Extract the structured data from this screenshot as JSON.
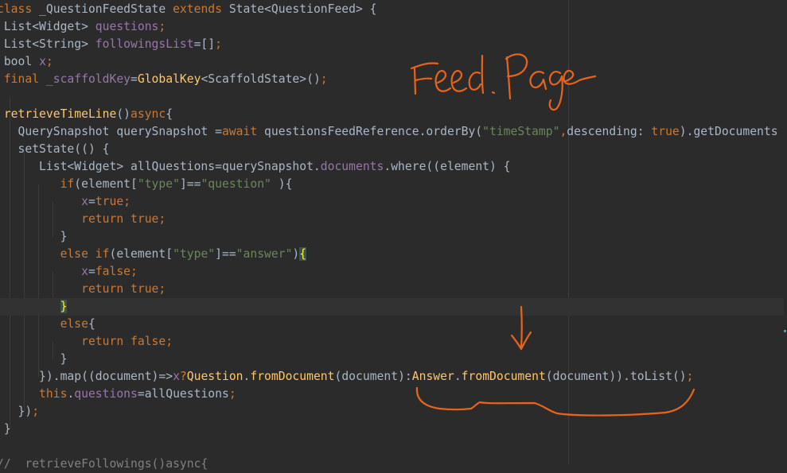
{
  "editor": {
    "lines": [
      [
        [
          "kw",
          "class"
        ],
        [
          "plain",
          " _QuestionFeedState "
        ],
        [
          "kw",
          "extends"
        ],
        [
          "plain",
          " State<QuestionFeed> {"
        ]
      ],
      [
        [
          "plain",
          " List<Widget> "
        ],
        [
          "field",
          "questions"
        ],
        [
          "kw",
          ";"
        ]
      ],
      [
        [
          "plain",
          " List<String> "
        ],
        [
          "field",
          "followingsList"
        ],
        [
          "plain",
          "=[]"
        ],
        [
          "kw",
          ";"
        ]
      ],
      [
        [
          "plain",
          " bool "
        ],
        [
          "field",
          "x"
        ],
        [
          "kw",
          ";"
        ]
      ],
      [
        [
          "kw",
          " final "
        ],
        [
          "field",
          "_scaffoldKey"
        ],
        [
          "plain",
          "="
        ],
        [
          "fn",
          "GlobalKey"
        ],
        [
          "plain",
          "<ScaffoldState>()"
        ],
        [
          "kw",
          ";"
        ]
      ],
      [],
      [
        [
          "fn",
          " retrieveTimeLine"
        ],
        [
          "plain",
          "()"
        ],
        [
          "kw",
          "async"
        ],
        [
          "plain",
          "{"
        ]
      ],
      [
        [
          "plain",
          "   QuerySnapshot querySnapshot ="
        ],
        [
          "kw",
          "await"
        ],
        [
          "plain",
          " questionsFeedReference.orderBy("
        ],
        [
          "str",
          "\"timeStamp\""
        ],
        [
          "kw",
          ","
        ],
        [
          "plain",
          "descending: "
        ],
        [
          "kw",
          "true"
        ],
        [
          "plain",
          ").getDocuments"
        ]
      ],
      [
        [
          "plain",
          "   setState(() {"
        ]
      ],
      [
        [
          "plain",
          "      List<Widget> allQuestions=querySnapshot."
        ],
        [
          "field",
          "documents"
        ],
        [
          "plain",
          ".where((element) {"
        ]
      ],
      [
        [
          "kw",
          "         if"
        ],
        [
          "plain",
          "(element["
        ],
        [
          "str",
          "\"type\""
        ],
        [
          "plain",
          "]=="
        ],
        [
          "str",
          "\"question\""
        ],
        [
          "plain",
          " ){"
        ]
      ],
      [
        [
          "field",
          "            x"
        ],
        [
          "plain",
          "="
        ],
        [
          "kw",
          "true;"
        ]
      ],
      [
        [
          "kw",
          "            return true;"
        ]
      ],
      [
        [
          "plain",
          "         }"
        ]
      ],
      [
        [
          "kw",
          "         else if"
        ],
        [
          "plain",
          "(element["
        ],
        [
          "str",
          "\"type\""
        ],
        [
          "plain",
          "]=="
        ],
        [
          "str",
          "\"answer\""
        ],
        [
          "plain",
          ")"
        ],
        [
          "brace",
          "{"
        ]
      ],
      [
        [
          "field",
          "            x"
        ],
        [
          "plain",
          "="
        ],
        [
          "kw",
          "false;"
        ]
      ],
      [
        [
          "kw",
          "            return true;"
        ]
      ],
      [
        [
          "plain",
          "         "
        ],
        [
          "brace",
          "}"
        ]
      ],
      [
        [
          "kw",
          "         else"
        ],
        [
          "plain",
          "{"
        ]
      ],
      [
        [
          "kw",
          "            return false;"
        ]
      ],
      [
        [
          "plain",
          "         }"
        ]
      ],
      [
        [
          "plain",
          "      }).map((document)=>"
        ],
        [
          "field",
          "x"
        ],
        [
          "kw",
          "?"
        ],
        [
          "fn",
          "Question"
        ],
        [
          "plain",
          "."
        ],
        [
          "fn",
          "fromDocument"
        ],
        [
          "plain",
          "(document):"
        ],
        [
          "fn",
          "Answer"
        ],
        [
          "plain",
          "."
        ],
        [
          "fn",
          "fromDocument"
        ],
        [
          "plain",
          "(document)).toList()"
        ],
        [
          "kw",
          ";"
        ]
      ],
      [
        [
          "kw",
          "      this"
        ],
        [
          "plain",
          "."
        ],
        [
          "field",
          "questions"
        ],
        [
          "plain",
          "=allQuestions"
        ],
        [
          "kw",
          ";"
        ]
      ],
      [
        [
          "plain",
          "   })"
        ],
        [
          "kw",
          ";"
        ]
      ],
      [
        [
          "plain",
          " }"
        ]
      ],
      [],
      [
        [
          "cmt",
          "//  retrieveFollowings()async{"
        ]
      ]
    ],
    "current_line": 17,
    "line_height": 22,
    "top": 1
  },
  "annotations": {
    "handwriting": "Feed. Page",
    "ink_color": "#e8641c"
  },
  "colors": {
    "background": "#2b2b2b",
    "keyword": "#cc7832",
    "plain": "#a9b7c6",
    "field": "#9876aa",
    "string": "#6a8759",
    "function": "#ffc66d",
    "comment": "#808080"
  }
}
